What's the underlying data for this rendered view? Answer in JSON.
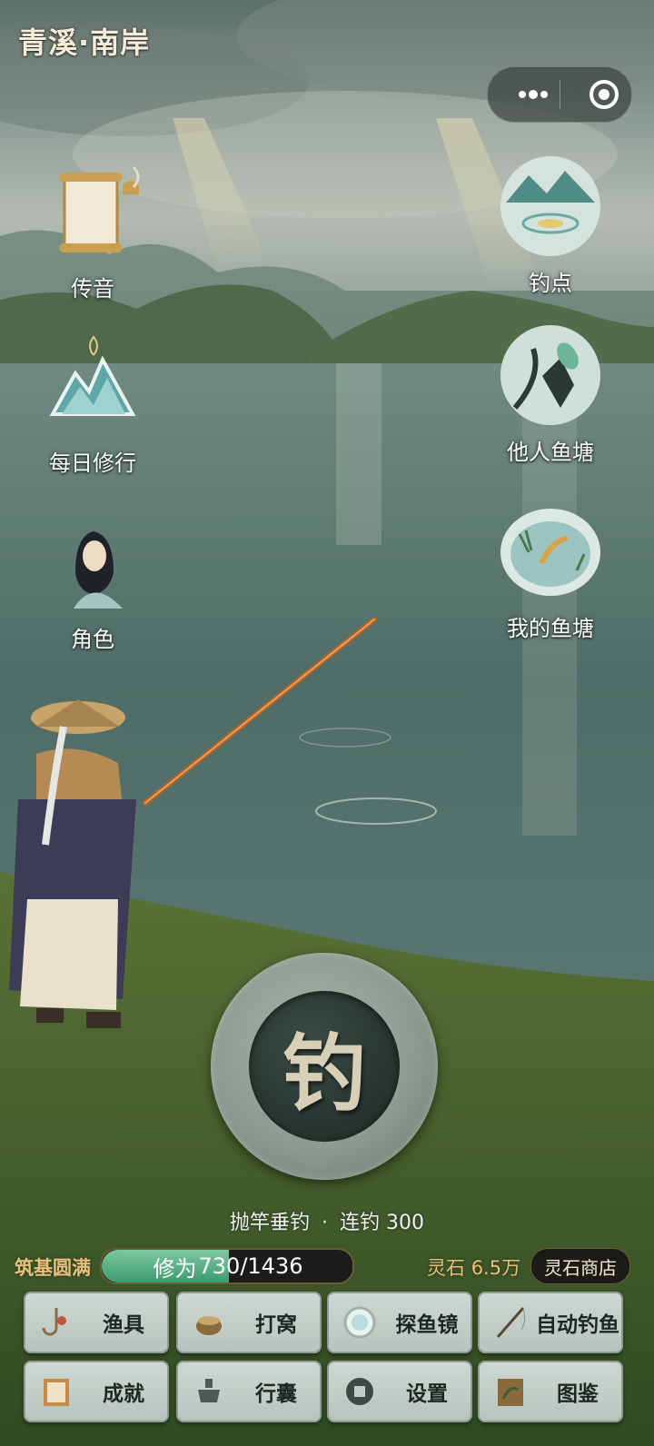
{
  "title": "青溪·南岸",
  "capsule": {
    "more_icon": "more-dots-icon",
    "close_icon": "target-circle-icon"
  },
  "left_menu": [
    {
      "label": "传音",
      "icon": "scroll-bell-icon"
    },
    {
      "label": "每日修行",
      "icon": "mountain-incense-icon"
    },
    {
      "label": "角色",
      "icon": "character-portrait-icon"
    }
  ],
  "right_menu": [
    {
      "label": "钓点",
      "icon": "lake-ripple-icon"
    },
    {
      "label": "他人鱼塘",
      "icon": "fisherman-ink-icon"
    },
    {
      "label": "我的鱼塘",
      "icon": "koi-pond-icon"
    }
  ],
  "cast": {
    "char": "钓",
    "status_action": "抛竿垂钓",
    "status_sep": "·",
    "status_streak": "连钓 300"
  },
  "cultivation": {
    "rank": "筑基圆满",
    "label": "修为",
    "current": "730",
    "max": "1436",
    "progress": 0.508
  },
  "currency": {
    "label": "灵石",
    "amount": "6.5万",
    "shop": "灵石商店"
  },
  "tools": [
    {
      "label": "渔具",
      "icon": "fishing-hook-icon"
    },
    {
      "label": "打窝",
      "icon": "bait-pot-icon"
    },
    {
      "label": "探鱼镜",
      "icon": "mirror-icon"
    },
    {
      "label": "自动钓鱼",
      "icon": "rod-icon"
    },
    {
      "label": "成就",
      "icon": "book-icon"
    },
    {
      "label": "行囊",
      "icon": "censer-icon"
    },
    {
      "label": "设置",
      "icon": "coin-gear-icon"
    },
    {
      "label": "图鉴",
      "icon": "album-icon"
    }
  ],
  "colors": {
    "gold": "#e7c27a",
    "water": "#4c6a63",
    "grass": "#3f5a2f",
    "tile": "#c3cec8"
  }
}
